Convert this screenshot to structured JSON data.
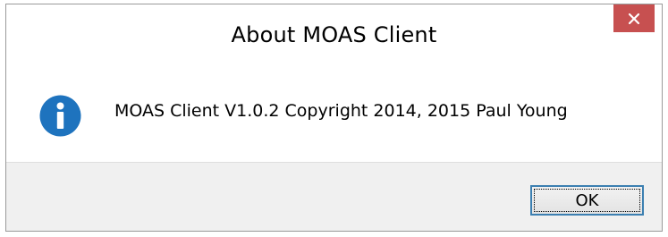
{
  "window": {
    "title": "About MOAS Client",
    "close_icon": "close-icon"
  },
  "content": {
    "icon": "info-icon",
    "message": "MOAS Client V1.0.2 Copyright 2014, 2015 Paul Young"
  },
  "footer": {
    "ok_label": "OK"
  },
  "colors": {
    "close_button_bg": "#c75050",
    "info_icon_blue": "#1e73be",
    "footer_bg": "#f0f0f0",
    "button_focus_border": "#3c7fb1"
  }
}
